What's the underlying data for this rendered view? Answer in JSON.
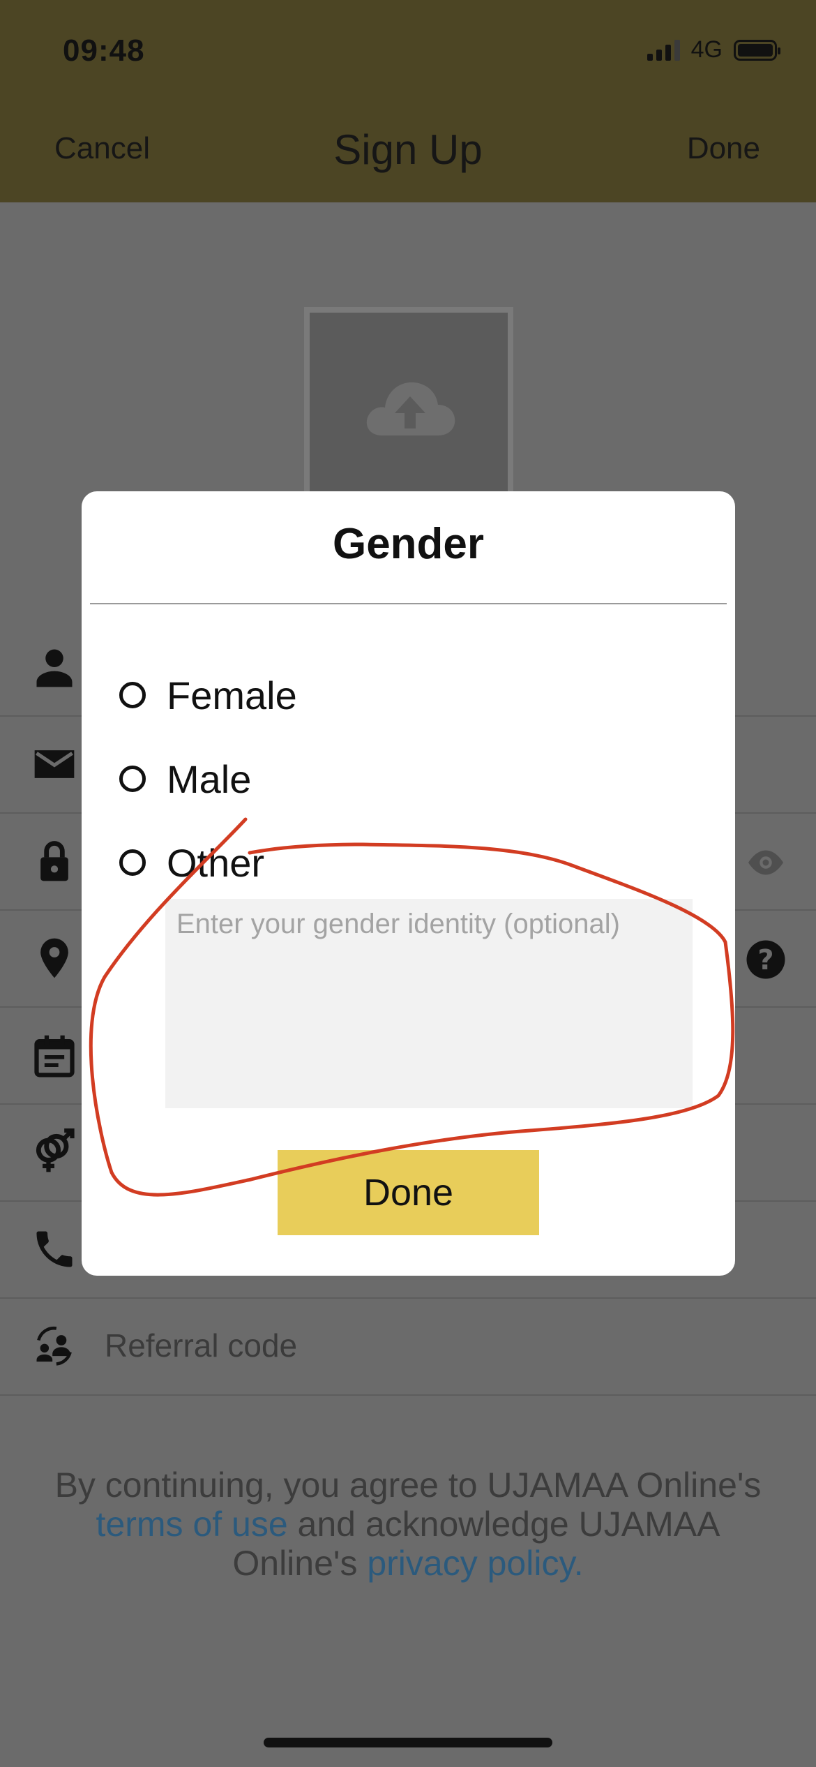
{
  "status_bar": {
    "time": "09:48",
    "network": "4G"
  },
  "nav": {
    "cancel": "Cancel",
    "title": "Sign Up",
    "done": "Done"
  },
  "form": {
    "rows": [
      {
        "icon": "person-icon",
        "label": ""
      },
      {
        "icon": "mail-icon",
        "label": ""
      },
      {
        "icon": "lock-icon",
        "label": "",
        "trailing_icon": "eye-icon"
      },
      {
        "icon": "location-pin-icon",
        "label": "",
        "trailing_icon": "help-icon"
      },
      {
        "icon": "calendar-icon",
        "label": ""
      },
      {
        "icon": "gender-icon",
        "label": ""
      },
      {
        "icon": "phone-icon",
        "label": ""
      },
      {
        "icon": "referral-icon",
        "label": "Referral code"
      }
    ]
  },
  "terms": {
    "prefix": "By continuing, you agree to UJAMAA Online's ",
    "terms_link": "terms of use",
    "middle": " and acknowledge UJAMAA Online's ",
    "privacy_link": "privacy policy."
  },
  "modal": {
    "title": "Gender",
    "options": [
      {
        "label": "Female",
        "selected": false
      },
      {
        "label": "Male",
        "selected": false
      },
      {
        "label": "Other",
        "selected": false
      }
    ],
    "identity_placeholder": "Enter your gender identity (optional)",
    "identity_value": "",
    "done_label": "Done"
  },
  "colors": {
    "nav_background": "#4c4524",
    "overlay_background": "#6b6b6b",
    "done_button": "#e8cd5a",
    "link": "#2b5a7d",
    "annotation": "#d23c22"
  }
}
